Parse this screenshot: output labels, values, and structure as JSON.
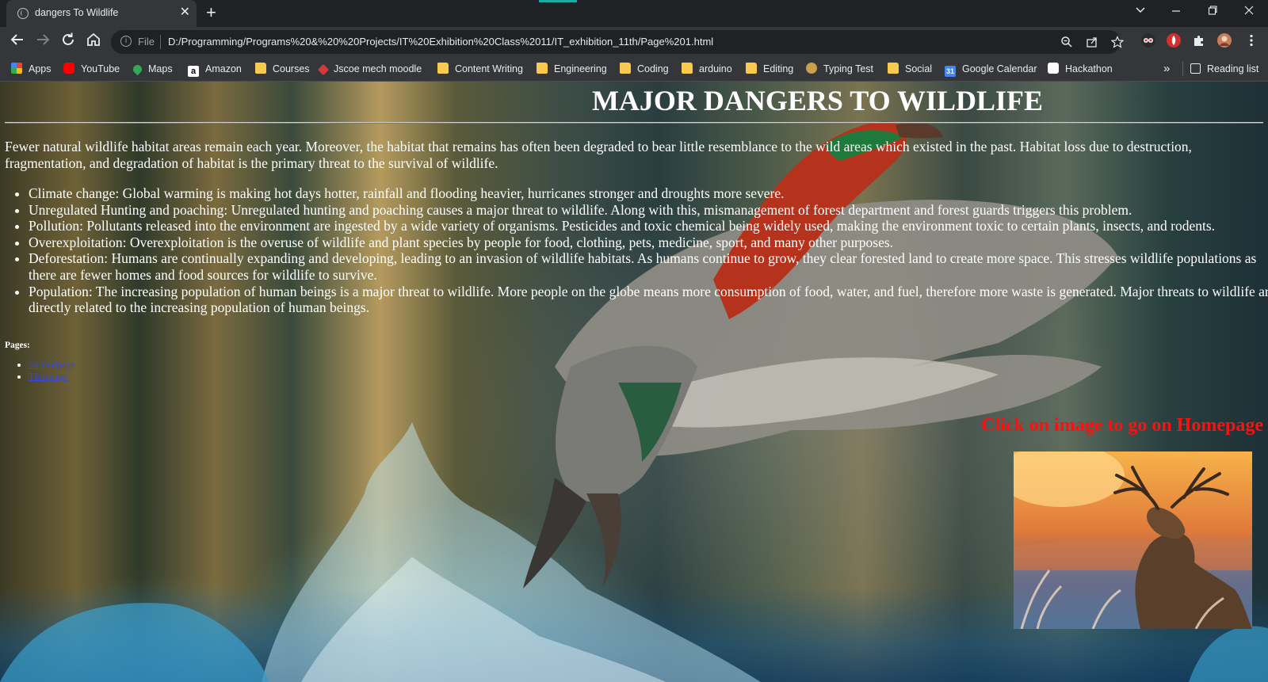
{
  "browser": {
    "tab_title": "dangers To Wildlife",
    "url_scheme_label": "File",
    "url": "D:/Programming/Programs%20&%20%20Projects/IT%20Exhibition%20Class%2011/IT_exhibition_11th/Page%201.html",
    "bookmarks": [
      {
        "label": "Apps",
        "icon": "apps-grid-icon",
        "color": "#ea4335"
      },
      {
        "label": "YouTube",
        "icon": "youtube-icon",
        "color": "#ff0000"
      },
      {
        "label": "Maps",
        "icon": "maps-pin-icon",
        "color": "#34a853"
      },
      {
        "label": "Amazon",
        "icon": "amazon-icon",
        "color": "#ffffff"
      },
      {
        "label": "Courses",
        "icon": "folder-icon",
        "color": "#f8ca4f"
      },
      {
        "label": "Jscoe mech moodle",
        "icon": "moodle-icon",
        "color": "#d63b3b"
      },
      {
        "label": "Content Writing",
        "icon": "folder-icon",
        "color": "#f8ca4f"
      },
      {
        "label": "Engineering",
        "icon": "folder-icon",
        "color": "#f8ca4f"
      },
      {
        "label": "Coding",
        "icon": "folder-icon",
        "color": "#f8ca4f"
      },
      {
        "label": "arduino",
        "icon": "folder-icon",
        "color": "#f8ca4f"
      },
      {
        "label": "Editing",
        "icon": "folder-icon",
        "color": "#f8ca4f"
      },
      {
        "label": "Typing Test",
        "icon": "typing-test-icon",
        "color": "#c9a14a"
      },
      {
        "label": "Social",
        "icon": "folder-icon",
        "color": "#f8ca4f"
      },
      {
        "label": "Google Calendar",
        "icon": "calendar-icon",
        "color": "#4285f4"
      },
      {
        "label": "Hackathon",
        "icon": "hackathon-icon",
        "color": "#ffffff"
      }
    ],
    "more_bookmarks_glyph": "»",
    "reading_list_label": "Reading list"
  },
  "page": {
    "heading": "MAJOR DANGERS TO WILDLIFE",
    "intro": "Fewer natural wildlife habitat areas remain each year. Moreover, the habitat that remains has often been degraded to bear little resemblance to the wild areas which existed in the past. Habitat loss due to destruction, fragmentation, and degradation of habitat is the primary threat to the survival of wildlife.",
    "dangers": [
      "Climate change: Global warming is making hot days hotter, rainfall and flooding heavier, hurricanes stronger and droughts more severe.",
      "Unregulated Hunting and poaching: Unregulated hunting and poaching causes a major threat to wildlife. Along with this, mismanagement of forest department and forest guards triggers this problem.",
      "Pollution: Pollutants released into the environment are ingested by a wide variety of organisms. Pesticides and toxic chemical being widely used, making the environment toxic to certain plants, insects, and rodents.",
      "Overexploitation: Overexploitation is the overuse of wildlife and plant species by people for food, clothing, pets, medicine, sport, and many other purposes.",
      "Deforestation: Humans are continually expanding and developing, leading to an invasion of wildlife habitats. As humans continue to grow, they clear forested land to create more space. This stresses wildlife populations as there are fewer homes and food sources for wildlife to survive.",
      "Population: The increasing population of human beings is a major threat to wildlife. More people on the globe means more consumption of food, water, and fuel, therefore more waste is generated. Major threats to wildlife are directly related to the increasing population of human beings."
    ],
    "pages_label": "Pages:",
    "page_links": [
      "Secondpage",
      "Thirdpage"
    ],
    "cta": "Click on image to go on Homepage"
  }
}
